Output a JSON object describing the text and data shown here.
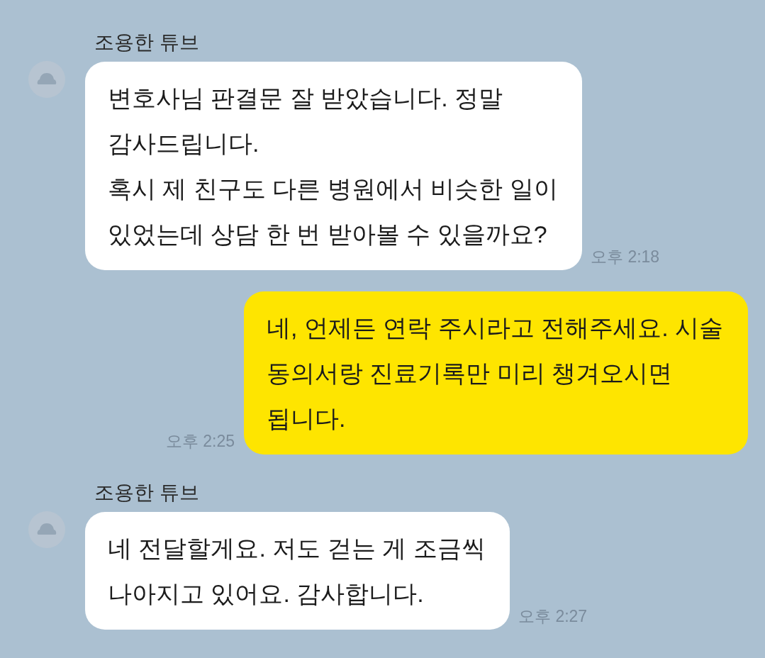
{
  "messages": [
    {
      "kind": "incoming",
      "sender": "조용한 튜브",
      "text": "변호사님 판결문 잘 받았습니다. 정말 감사드립니다.\n혹시 제 친구도 다른 병원에서 비슷한 일이 있었는데 상담 한 번 받아볼 수 있을까요?",
      "time": "오후 2:18"
    },
    {
      "kind": "outgoing",
      "text": "네, 언제든 연락 주시라고 전해주세요. 시술 동의서랑 진료기록만 미리 챙겨오시면 됩니다.",
      "time": "오후 2:25"
    },
    {
      "kind": "incoming",
      "sender": "조용한 튜브",
      "text": "네 전달할게요. 저도 걷는 게 조금씩 나아지고 있어요. 감사합니다.",
      "time": "오후 2:27"
    }
  ]
}
